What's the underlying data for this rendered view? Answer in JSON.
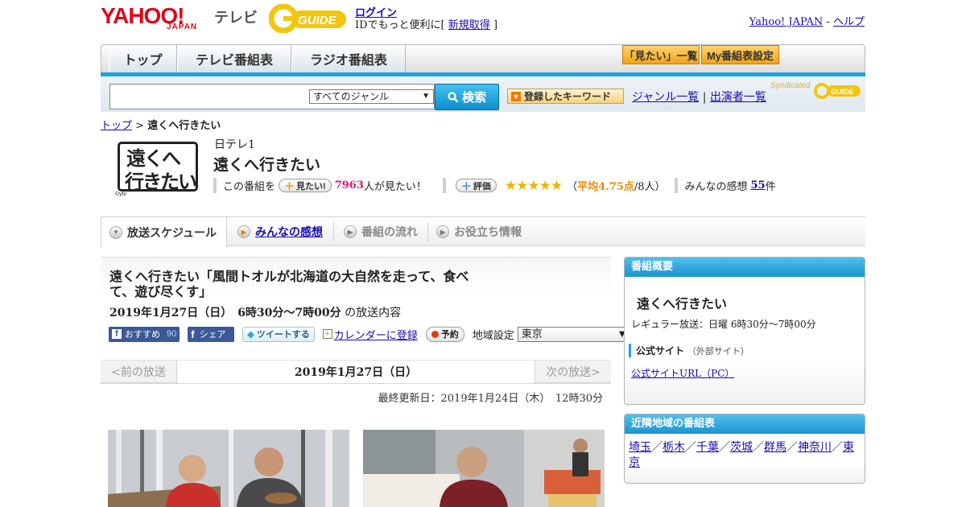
{
  "header": {
    "logo_yahoo": "YAHOO!",
    "logo_japan": "JAPAN",
    "logo_tv": "テレビ",
    "logo_gguide": "G GUIDE",
    "login": "ログイン",
    "login_prompt": "IDでもっと便利に[",
    "register": "新規取得",
    "login_close": "]",
    "yahoo_japan": "Yahoo! JAPAN",
    "dash": "-",
    "help": "ヘルプ"
  },
  "nav": {
    "tabs": [
      {
        "label": "トップ"
      },
      {
        "label": "テレビ番組表"
      },
      {
        "label": "ラジオ番組表"
      }
    ],
    "mitai_list": "「見たい」一覧",
    "my_schedule": "My番組表設定"
  },
  "search": {
    "genre_selected": "すべてのジャンル",
    "button": "検索",
    "keyword_button": "登録したキーワード",
    "genre_list": "ジャンル一覧",
    "separator": "|",
    "performer_list": "出演者一覧",
    "syndicated": "Syndicated"
  },
  "breadcrumb": {
    "top": "トップ",
    "sep": ">",
    "current": "遠くへ行きたい"
  },
  "program": {
    "logo_line1": "遠くへ",
    "logo_line2": "行きたい",
    "logo_credit": "©ytv",
    "channel": "日テレ1",
    "title": "遠くへ行きたい",
    "this_program": "この番組を",
    "mitai_button": "見たい!",
    "mitai_count": "7963",
    "mitai_suffix": "人が見たい！",
    "rating_button": "評価",
    "stars": "★★★★★",
    "rating_open": "（",
    "rating_avg": "平均4.75点",
    "rating_count": "/8人）",
    "reviews_label": "みんなの感想",
    "reviews_count": "55",
    "reviews_suffix": "件"
  },
  "tabs": [
    {
      "label": "放送スケジュール"
    },
    {
      "label": "みんなの感想"
    },
    {
      "label": "番組の流れ"
    },
    {
      "label": "お役立ち情報"
    }
  ],
  "episode": {
    "title": "遠くへ行きたい「風間トオルが北海道の大自然を走って、食べて、遊び尽くす」",
    "date": "2019年1月27日（日）　6時30分～7時00分",
    "date_suffix": "の放送内容",
    "fb_recommend": "おすすめ",
    "fb_count": "90",
    "fb_share": "シェア",
    "tweet": "ツイートする",
    "calendar": "カレンダーに登録",
    "reserve": "予約",
    "region_label": "地域設定",
    "region_selected": "東京"
  },
  "pager": {
    "prev": "<前の放送",
    "date": "2019年1月27日（日）",
    "next": "次の放送>"
  },
  "updated": "最終更新日：2019年1月24日（木）　12時30分",
  "sidebar": {
    "overview_head": "番組概要",
    "overview_title": "遠くへ行きたい",
    "regular": "レギュラー放送：日曜 6時30分～7時00分",
    "official_site": "公式サイト",
    "official_site_ext": "（外部サイト）",
    "official_url": "公式サイトURL（PC）",
    "nearby_head": "近隣地域の番組表",
    "regions": [
      "埼玉",
      "栃木",
      "千葉",
      "茨城",
      "群馬",
      "神奈川",
      "東京"
    ],
    "region_sep": "／"
  },
  "colors": {
    "accent_blue": "#1fa3df",
    "star": "#f0b400",
    "mitai_count": "#e0157b",
    "avg": "#ee8a00"
  }
}
